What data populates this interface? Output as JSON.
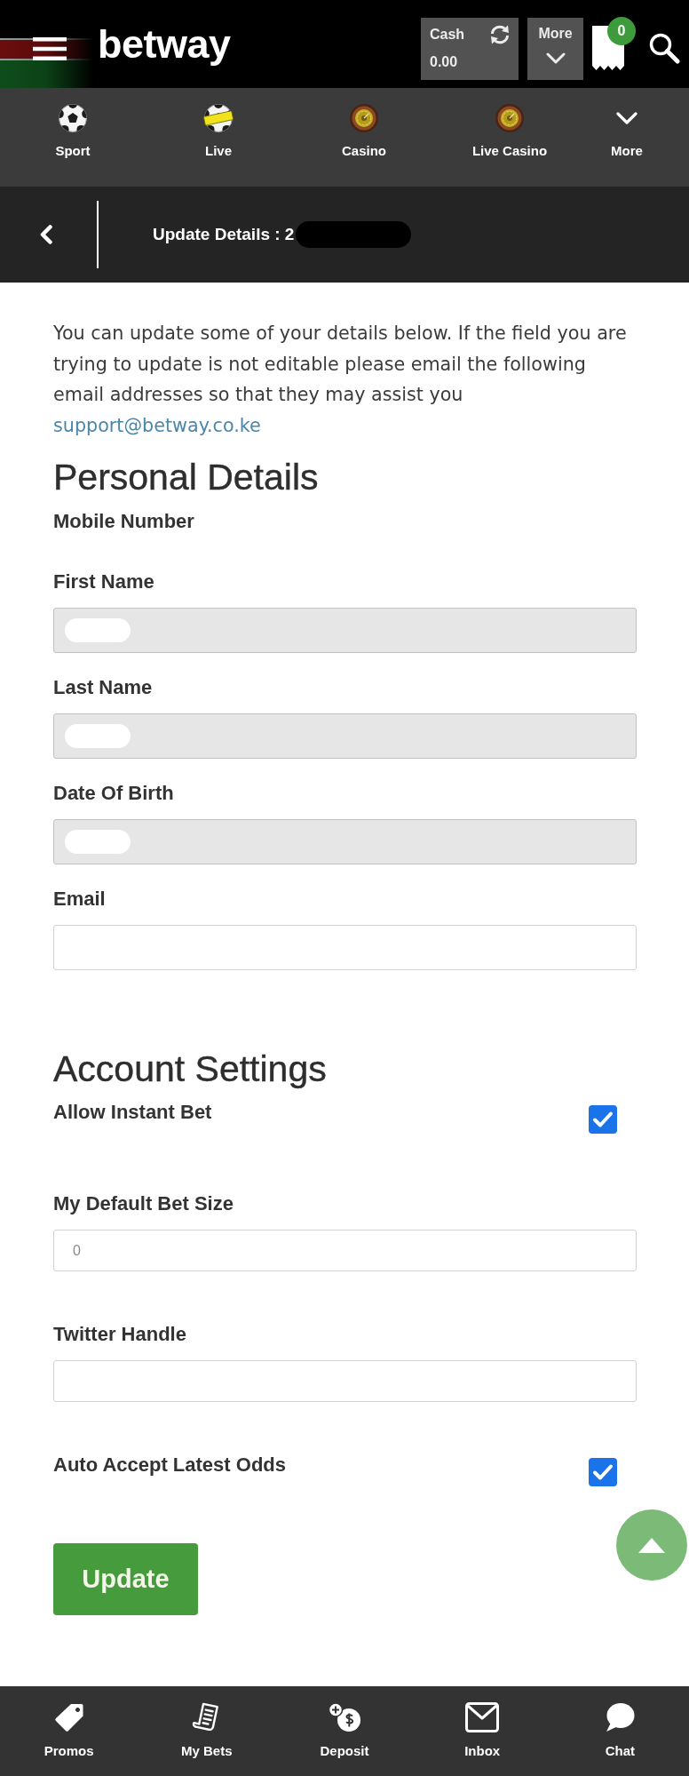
{
  "header": {
    "logo": "betway",
    "cash": {
      "label": "Cash",
      "amount": "0.00"
    },
    "more": {
      "label": "More"
    },
    "betslip_count": "0"
  },
  "top_nav": [
    {
      "label": "Sport",
      "kind": "ball"
    },
    {
      "label": "Live",
      "kind": "live"
    },
    {
      "label": "Casino",
      "kind": "roulette"
    },
    {
      "label": "Live Casino",
      "kind": "roulette"
    },
    {
      "label": "More",
      "kind": "chevron"
    }
  ],
  "page_header": {
    "title": "Update Details : 2",
    "redacted": true
  },
  "intro": {
    "text": "You can update some of your details below. If the field you are trying to update is not editable please email the following email addresses so that they may assist you",
    "link": "support@betway.co.ke"
  },
  "sections": [
    {
      "heading": "Personal Details",
      "fields": [
        {
          "kind": "info",
          "label": "Mobile Number"
        },
        {
          "kind": "input",
          "label": "First Name",
          "disabled": true,
          "redacted": true
        },
        {
          "kind": "input",
          "label": "Last Name",
          "disabled": true,
          "redacted": true
        },
        {
          "kind": "input",
          "label": "Date Of Birth",
          "disabled": true,
          "redacted": true
        },
        {
          "kind": "input",
          "label": "Email",
          "disabled": false,
          "redacted": false
        }
      ]
    },
    {
      "heading": "Account Settings",
      "fields": [
        {
          "kind": "checkbox",
          "label": "Allow Instant Bet",
          "checked": true
        },
        {
          "kind": "input",
          "label": "My Default Bet Size",
          "placeholder": "0",
          "disabled": false,
          "redacted": false
        },
        {
          "kind": "input",
          "label": "Twitter Handle",
          "disabled": false,
          "redacted": false
        },
        {
          "kind": "checkbox",
          "label": "Auto Accept Latest Odds",
          "checked": true
        }
      ]
    }
  ],
  "submit_button": {
    "label": "Update"
  },
  "bottom_nav": [
    {
      "label": "Promos",
      "kind": "tag"
    },
    {
      "label": "My Bets",
      "kind": "bets"
    },
    {
      "label": "Deposit",
      "kind": "deposit"
    },
    {
      "label": "Inbox",
      "kind": "inbox"
    },
    {
      "label": "Chat",
      "kind": "chat"
    }
  ]
}
